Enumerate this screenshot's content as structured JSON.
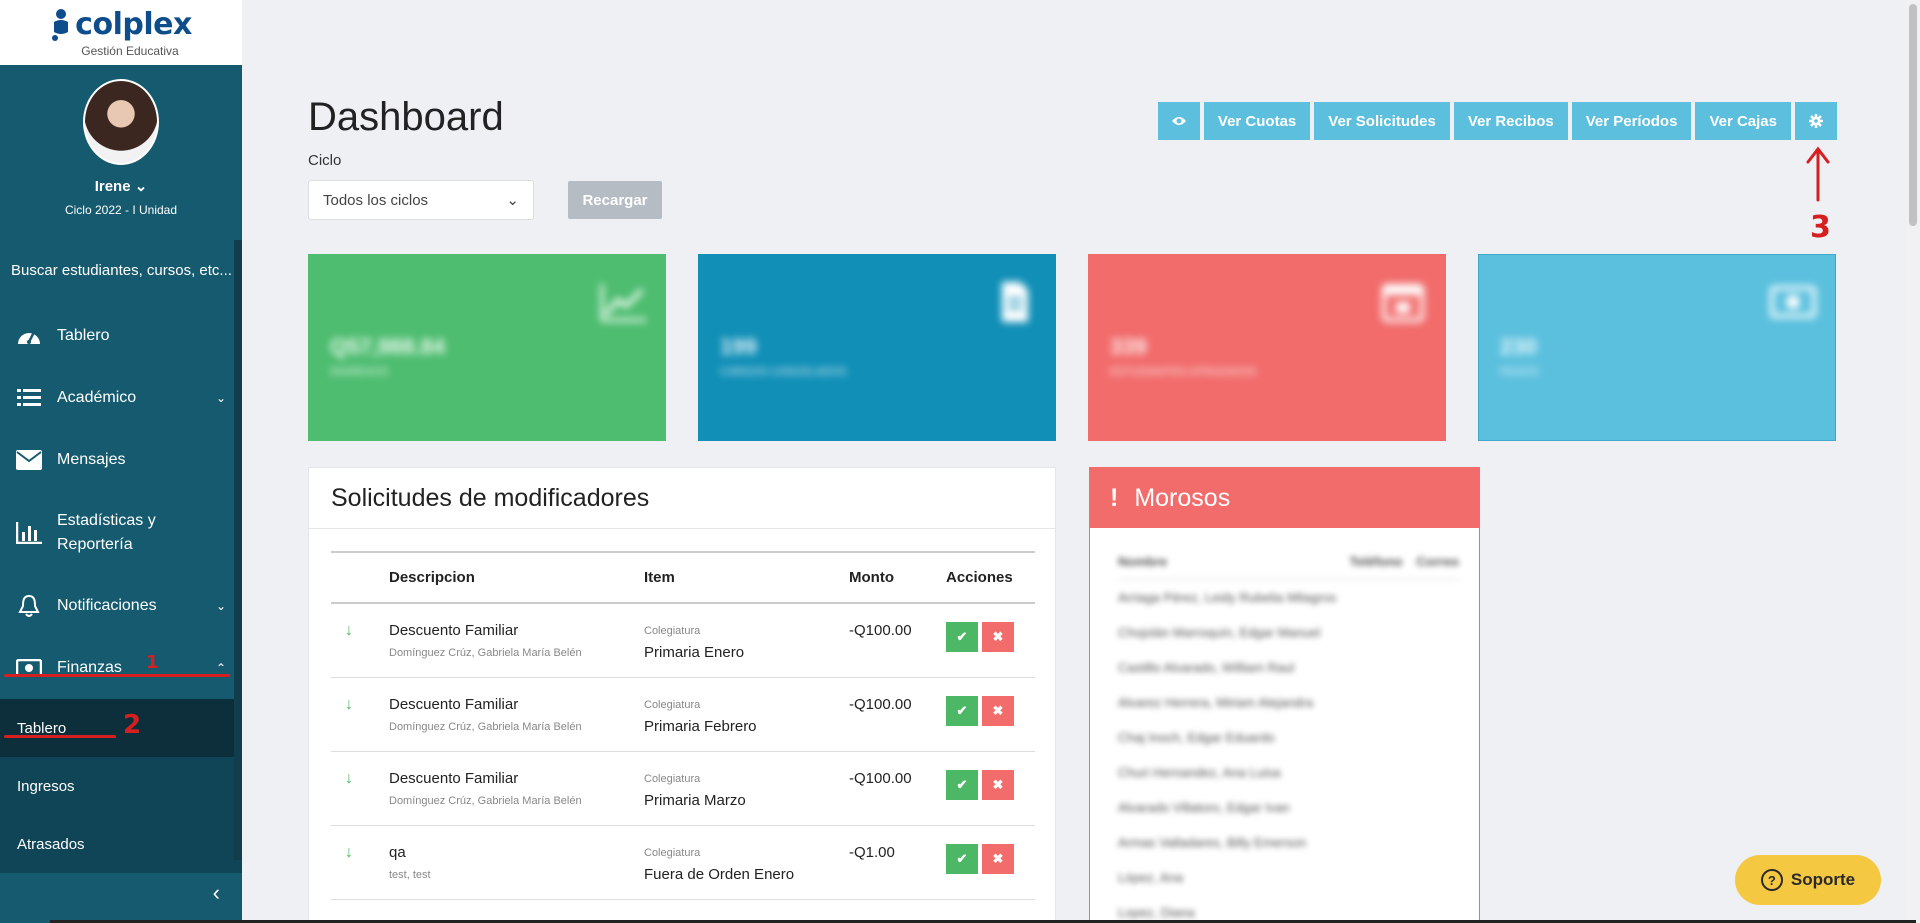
{
  "brand": {
    "name": "colplex",
    "tagline": "Gestión Educativa"
  },
  "user": {
    "name": "Irene",
    "cycle": "Ciclo 2022 - I Unidad"
  },
  "sidebar": {
    "search": "Buscar estudiantes, cursos, etc...",
    "items": [
      {
        "label": "Tablero",
        "icon": "dashboard-icon"
      },
      {
        "label": "Académico",
        "icon": "list-icon"
      },
      {
        "label": "Mensajes",
        "icon": "envelope-icon"
      },
      {
        "label": "Estadísticas y Reportería",
        "icon": "bar-chart-icon"
      },
      {
        "label": "Notificaciones",
        "icon": "bell-icon"
      },
      {
        "label": "Finanzas",
        "icon": "money-icon"
      }
    ],
    "subitems": [
      "Tablero",
      "Ingresos",
      "Atrasados"
    ]
  },
  "page": {
    "title": "Dashboard",
    "ciclo_label": "Ciclo",
    "ciclo_value": "Todos los ciclos",
    "reload": "Recargar"
  },
  "toolbar": [
    "Ver Cuotas",
    "Ver Solicitudes",
    "Ver Recibos",
    "Ver Períodos",
    "Ver Cajas"
  ],
  "stats": [
    {
      "value": "Q57,988.84",
      "label": "INGRESOS",
      "color": "#4ebd70"
    },
    {
      "value": "199",
      "label": "CARGOS CANCELADOS",
      "color": "#118fb7"
    },
    {
      "value": "339",
      "label": "ESTUDIANTES ATRASADOS",
      "color": "#f26c6c"
    },
    {
      "value": "230",
      "label": "PAGOS",
      "color": "#5bc0de"
    }
  ],
  "solicitudes": {
    "title": "Solicitudes de modificadores",
    "headers": [
      "Descripcion",
      "Item",
      "Monto",
      "Acciones"
    ],
    "rows": [
      {
        "desc": "Descuento Familiar",
        "person": "Domínguez Crúz, Gabriela María Belén",
        "cat": "Colegiatura",
        "item": "Primaria Enero",
        "amount": "-Q100.00"
      },
      {
        "desc": "Descuento Familiar",
        "person": "Domínguez Crúz, Gabriela María Belén",
        "cat": "Colegiatura",
        "item": "Primaria Febrero",
        "amount": "-Q100.00"
      },
      {
        "desc": "Descuento Familiar",
        "person": "Domínguez Crúz, Gabriela María Belén",
        "cat": "Colegiatura",
        "item": "Primaria Marzo",
        "amount": "-Q100.00"
      },
      {
        "desc": "qa",
        "person": "test, test",
        "cat": "Colegiatura",
        "item": "Fuera de Orden Enero",
        "amount": "-Q1.00"
      }
    ]
  },
  "morosos": {
    "title": "Morosos",
    "headers": [
      "Nombre",
      "Teléfono",
      "Correo"
    ],
    "rows": [
      "Arriaga Pérez, Leidy Rubelia Milagros",
      "Chojolán Marroquín, Edgar Manuel",
      "Castillo Alvarado, William Raul",
      "Alvarez Herrera, Miriam Alejandra",
      "Chaj Inoch, Edgar Eduardo",
      "Churi Hernandez, Ana Luisa",
      "Alvarado Villatoro, Edgar Ivan",
      "Armas Valladares, Billy Emerson",
      "López, Ana",
      "Lopez, Diana"
    ]
  },
  "support": "Soporte",
  "annotations": [
    "1",
    "2",
    "3"
  ]
}
